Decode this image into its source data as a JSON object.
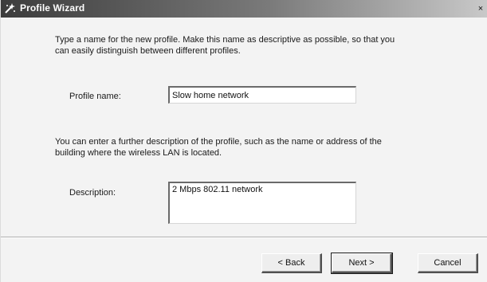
{
  "window": {
    "title": "Profile Wizard",
    "close_glyph": "×"
  },
  "icons": {
    "title_icon": "wizard-icon",
    "close_icon": "close-icon"
  },
  "intro": {
    "line1": "Type a name for the new profile. Make this name as descriptive as possible, so that you",
    "line2": "can easily distinguish between different profiles."
  },
  "profile_name": {
    "label": "Profile name:",
    "value": "Slow home network"
  },
  "description_help": {
    "line1": "You can enter a further description of the profile, such as the name or address of the",
    "line2": "building where the wireless LAN is located."
  },
  "description": {
    "label": "Description:",
    "value": "2 Mbps 802.11 network"
  },
  "buttons": {
    "back": "< Back",
    "next": "Next >",
    "cancel": "Cancel"
  },
  "colors": {
    "titlebar_start": "#3c3c3c",
    "titlebar_end": "#c9c9c9",
    "dialog_background": "#f3f3f3"
  }
}
